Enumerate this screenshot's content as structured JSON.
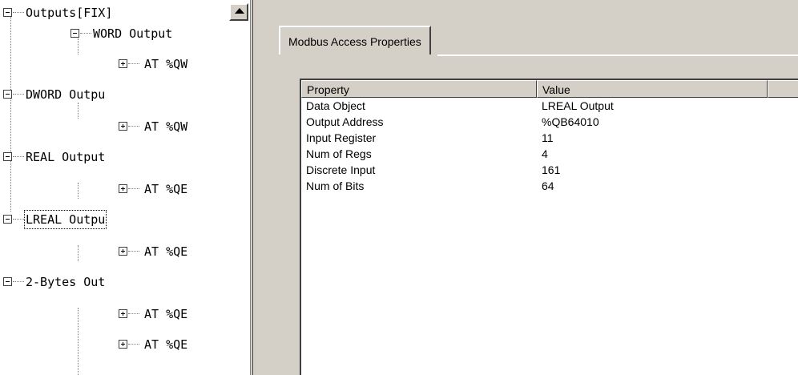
{
  "tree": {
    "nodes": [
      {
        "label": "Outputs[FIX]",
        "expander": "minus"
      },
      {
        "label": "WORD Output",
        "expander": "minus"
      },
      {
        "label": "AT %QW",
        "expander": "plus"
      },
      {
        "label": "DWORD Outpu",
        "expander": "minus"
      },
      {
        "label": "AT %QW",
        "expander": "plus"
      },
      {
        "label": "REAL Output",
        "expander": "minus"
      },
      {
        "label": "AT %QE",
        "expander": "plus"
      },
      {
        "label": "LREAL Outpu",
        "expander": "minus",
        "focused": true
      },
      {
        "label": "AT %QE",
        "expander": "plus"
      },
      {
        "label": "2-Bytes Out",
        "expander": "minus"
      },
      {
        "label": "AT %QE",
        "expander": "plus"
      },
      {
        "label": "AT %QE",
        "expander": "plus"
      }
    ]
  },
  "panel": {
    "tab_label": "Modbus Access Properties",
    "grid": {
      "headers": [
        "Property",
        "Value",
        ""
      ],
      "rows": [
        {
          "property": "Data Object",
          "value": "LREAL Output"
        },
        {
          "property": "Output Address",
          "value": "%QB64010"
        },
        {
          "property": "Input Register",
          "value": "11"
        },
        {
          "property": "Num of Regs",
          "value": "4"
        },
        {
          "property": "Discrete Input",
          "value": "161"
        },
        {
          "property": "Num of Bits",
          "value": "64"
        }
      ]
    }
  }
}
